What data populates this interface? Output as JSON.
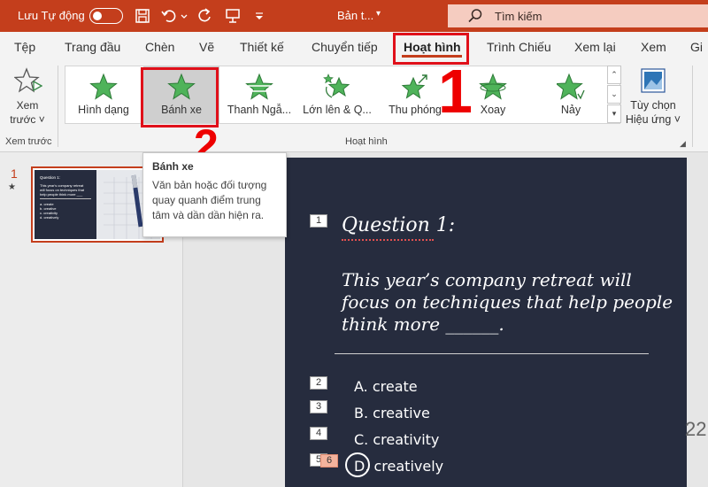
{
  "title_bar": {
    "autosave_label": "Lưu Tự động",
    "doc_title": "Bản t...",
    "title_caret": "▾",
    "search_placeholder": "Tìm kiếm"
  },
  "tabs": [
    {
      "label": "Tệp"
    },
    {
      "label": "Trang đầu"
    },
    {
      "label": "Chèn"
    },
    {
      "label": "Vẽ"
    },
    {
      "label": "Thiết kế"
    },
    {
      "label": "Chuyển tiếp"
    },
    {
      "label": "Hoạt hình",
      "active": true
    },
    {
      "label": "Trình Chiếu"
    },
    {
      "label": "Xem lại"
    },
    {
      "label": "Xem"
    },
    {
      "label": "Gi"
    }
  ],
  "ribbon": {
    "preview": {
      "line1": "Xem",
      "line2": "trước ˅",
      "group_label": "Xem trước"
    },
    "gallery_items": [
      {
        "label": "Hình dạng",
        "selected": false
      },
      {
        "label": "Bánh xe",
        "selected": true
      },
      {
        "label": "Thanh Ngẫ...",
        "selected": false
      },
      {
        "label": "Lớn lên & Q...",
        "selected": false
      },
      {
        "label": "Thu phóng",
        "selected": false
      },
      {
        "label": "Xoay",
        "selected": false
      },
      {
        "label": "Nảy",
        "selected": false
      }
    ],
    "group_label": "Hoạt hình",
    "effect_options": {
      "line1": "Tùy chọn",
      "line2": "Hiệu ứng ˅"
    }
  },
  "annotations": {
    "one": "1",
    "two": "2"
  },
  "tooltip": {
    "title": "Bánh xe",
    "body": "Văn bản hoặc đối tượng quay quanh điểm trung tâm và dần dần hiện ra."
  },
  "thumbnail": {
    "number": "1",
    "star": "★",
    "lines": [
      "Question 1:",
      "This year's company retreat",
      "will focus on techniques that",
      "help people think more ___",
      "a. create",
      "b. creative",
      "c. creativity",
      "d. creatively"
    ]
  },
  "slide": {
    "question_title": "Question 1:",
    "question_text": "This year’s company retreat will focus on techniques that help people think more ______.",
    "answers": [
      {
        "tag": "2",
        "text": "A. create"
      },
      {
        "tag": "3",
        "text": "B. creative"
      },
      {
        "tag": "4",
        "text": "C. creativity"
      },
      {
        "tag": "5",
        "text": "D. creatively"
      }
    ],
    "title_tag": "1",
    "selected_tag": "6",
    "side_number": "22"
  },
  "colors": {
    "accent": "#c43e1c",
    "slide_bg": "#262c3e",
    "annotation_red": "#ee0000",
    "star_green": "#4fb35a"
  }
}
